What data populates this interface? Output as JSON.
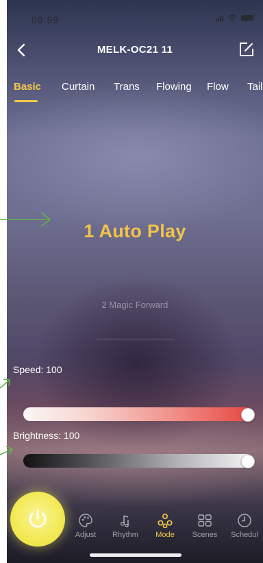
{
  "status_bar": {
    "time": "09:59"
  },
  "header": {
    "title": "MELK-OC21  11"
  },
  "tabs": [
    {
      "label": "Basic",
      "active": true
    },
    {
      "label": "Curtain",
      "active": false
    },
    {
      "label": "Trans",
      "active": false
    },
    {
      "label": "Flowing",
      "active": false
    },
    {
      "label": "Flow",
      "active": false
    },
    {
      "label": "Tail",
      "active": false
    }
  ],
  "modes": {
    "selected": "1 Auto Play",
    "next": "2 Magic Forward"
  },
  "speed": {
    "label": "Speed: 100",
    "value": 100,
    "max": 100
  },
  "brightness": {
    "label": "Brightness: 100",
    "value": 100,
    "max": 100
  },
  "bottom_nav": [
    {
      "label": "Adjust",
      "icon": "palette-icon",
      "active": false
    },
    {
      "label": "Rhythm",
      "icon": "music-note-icon",
      "active": false
    },
    {
      "label": "Mode",
      "icon": "mode-icon",
      "active": true
    },
    {
      "label": "Scenes",
      "icon": "grid-icon",
      "active": false
    },
    {
      "label": "Schedul",
      "icon": "clock-icon",
      "active": false
    }
  ],
  "colors": {
    "accent": "#f4c84a",
    "power_button": "#f3ea58",
    "speed_gradient_end": "#e7463f"
  }
}
